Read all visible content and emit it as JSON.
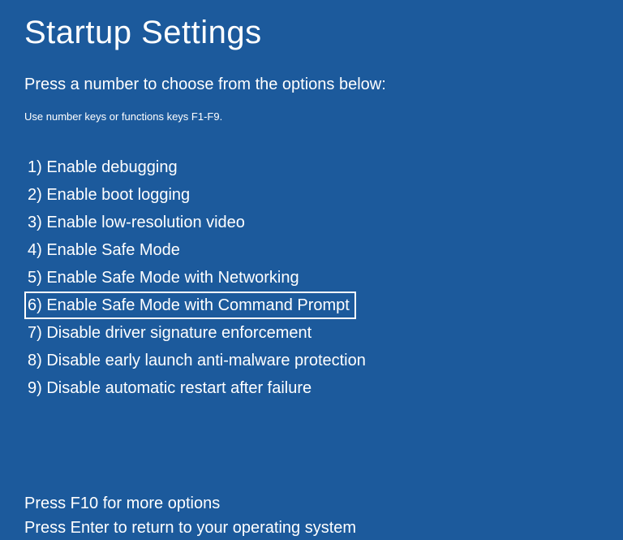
{
  "title": "Startup Settings",
  "subtitle": "Press a number to choose from the options below:",
  "hint": "Use number keys or functions keys F1-F9.",
  "options": [
    "1) Enable debugging",
    "2) Enable boot logging",
    "3) Enable low-resolution video",
    "4) Enable Safe Mode",
    "5) Enable Safe Mode with Networking",
    "6) Enable Safe Mode with Command Prompt",
    "7) Disable driver signature enforcement",
    "8) Disable early launch anti-malware protection",
    "9) Disable automatic restart after failure"
  ],
  "footer": {
    "more": "Press F10 for more options",
    "return": "Press Enter to return to your operating system"
  }
}
